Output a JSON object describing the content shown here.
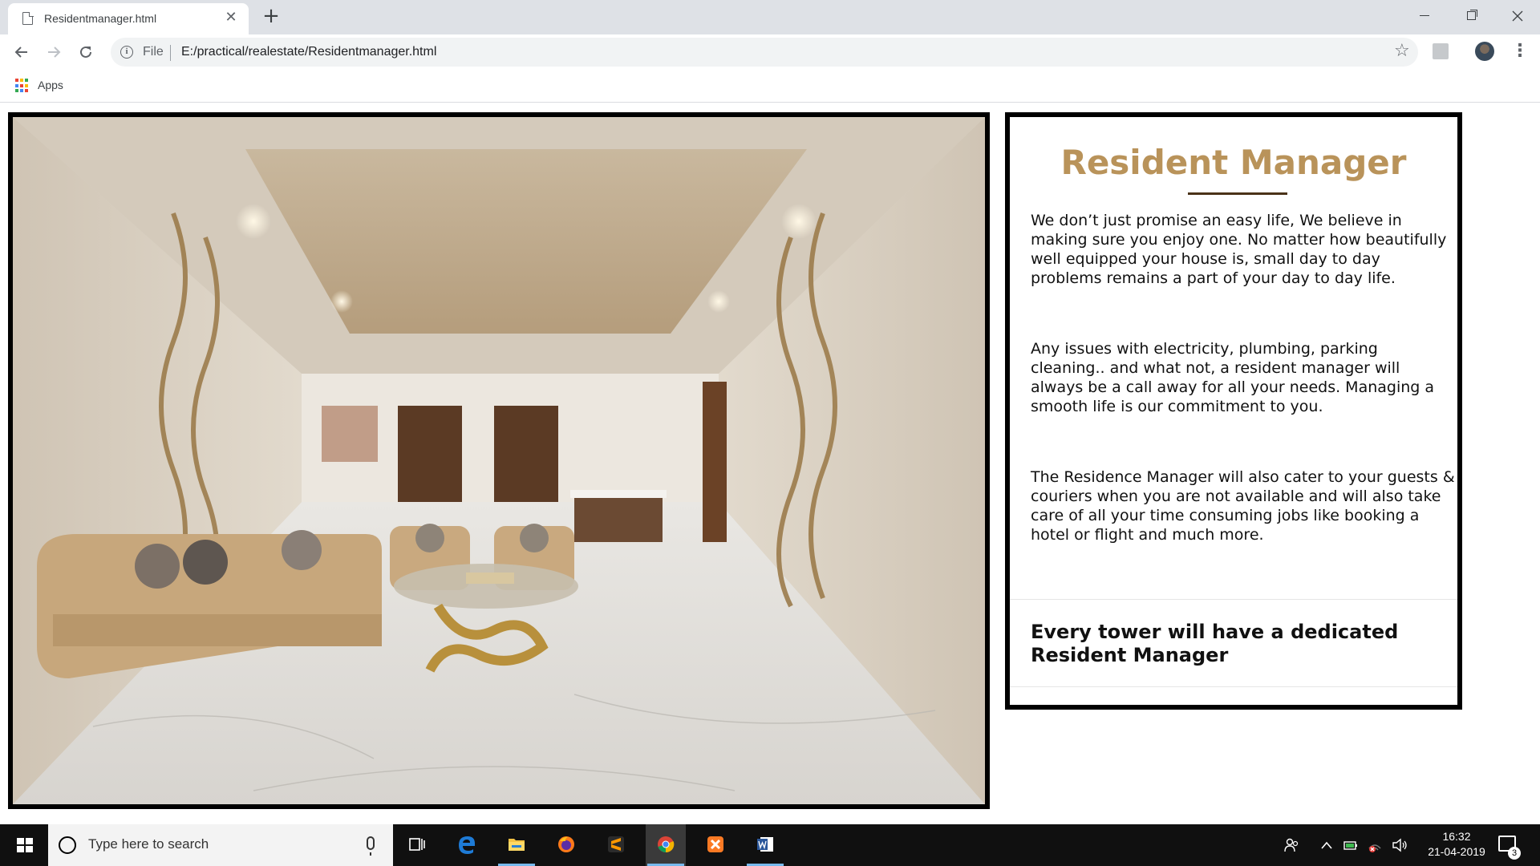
{
  "browser": {
    "tab_title": "Residentmanager.html",
    "tab_close": "✕",
    "new_tab": "+",
    "url_scheme": "File",
    "url": "E:/practical/realestate/Residentmanager.html",
    "bookmarks_apps_label": "Apps"
  },
  "content": {
    "title": "Resident Manager",
    "paragraphs": [
      "We don’t just promise an easy life, We believe in making sure you enjoy one. No matter how beautifully well equipped your house is, small day to day problems remains a part of your day to day life.",
      "Any issues with electricity, plumbing, parking cleaning.. and what not, a resident manager will always be a call away for all your needs. Managing a smooth life is our commitment to you.",
      "The Residence Manager will also cater to your guests & couriers when you are not available and will also take care of all your time consuming jobs like booking a hotel or flight and much more."
    ],
    "footer": "Every tower will have a dedicated Resident Manager",
    "title_color": "#b9935a"
  },
  "taskbar": {
    "search_placeholder": "Type here to search",
    "time": "16:32",
    "date": "21-04-2019",
    "notification_count": "3",
    "apps": [
      "task-view",
      "edge",
      "file-explorer",
      "firefox",
      "sublime-text",
      "chrome",
      "xampp",
      "word"
    ]
  }
}
